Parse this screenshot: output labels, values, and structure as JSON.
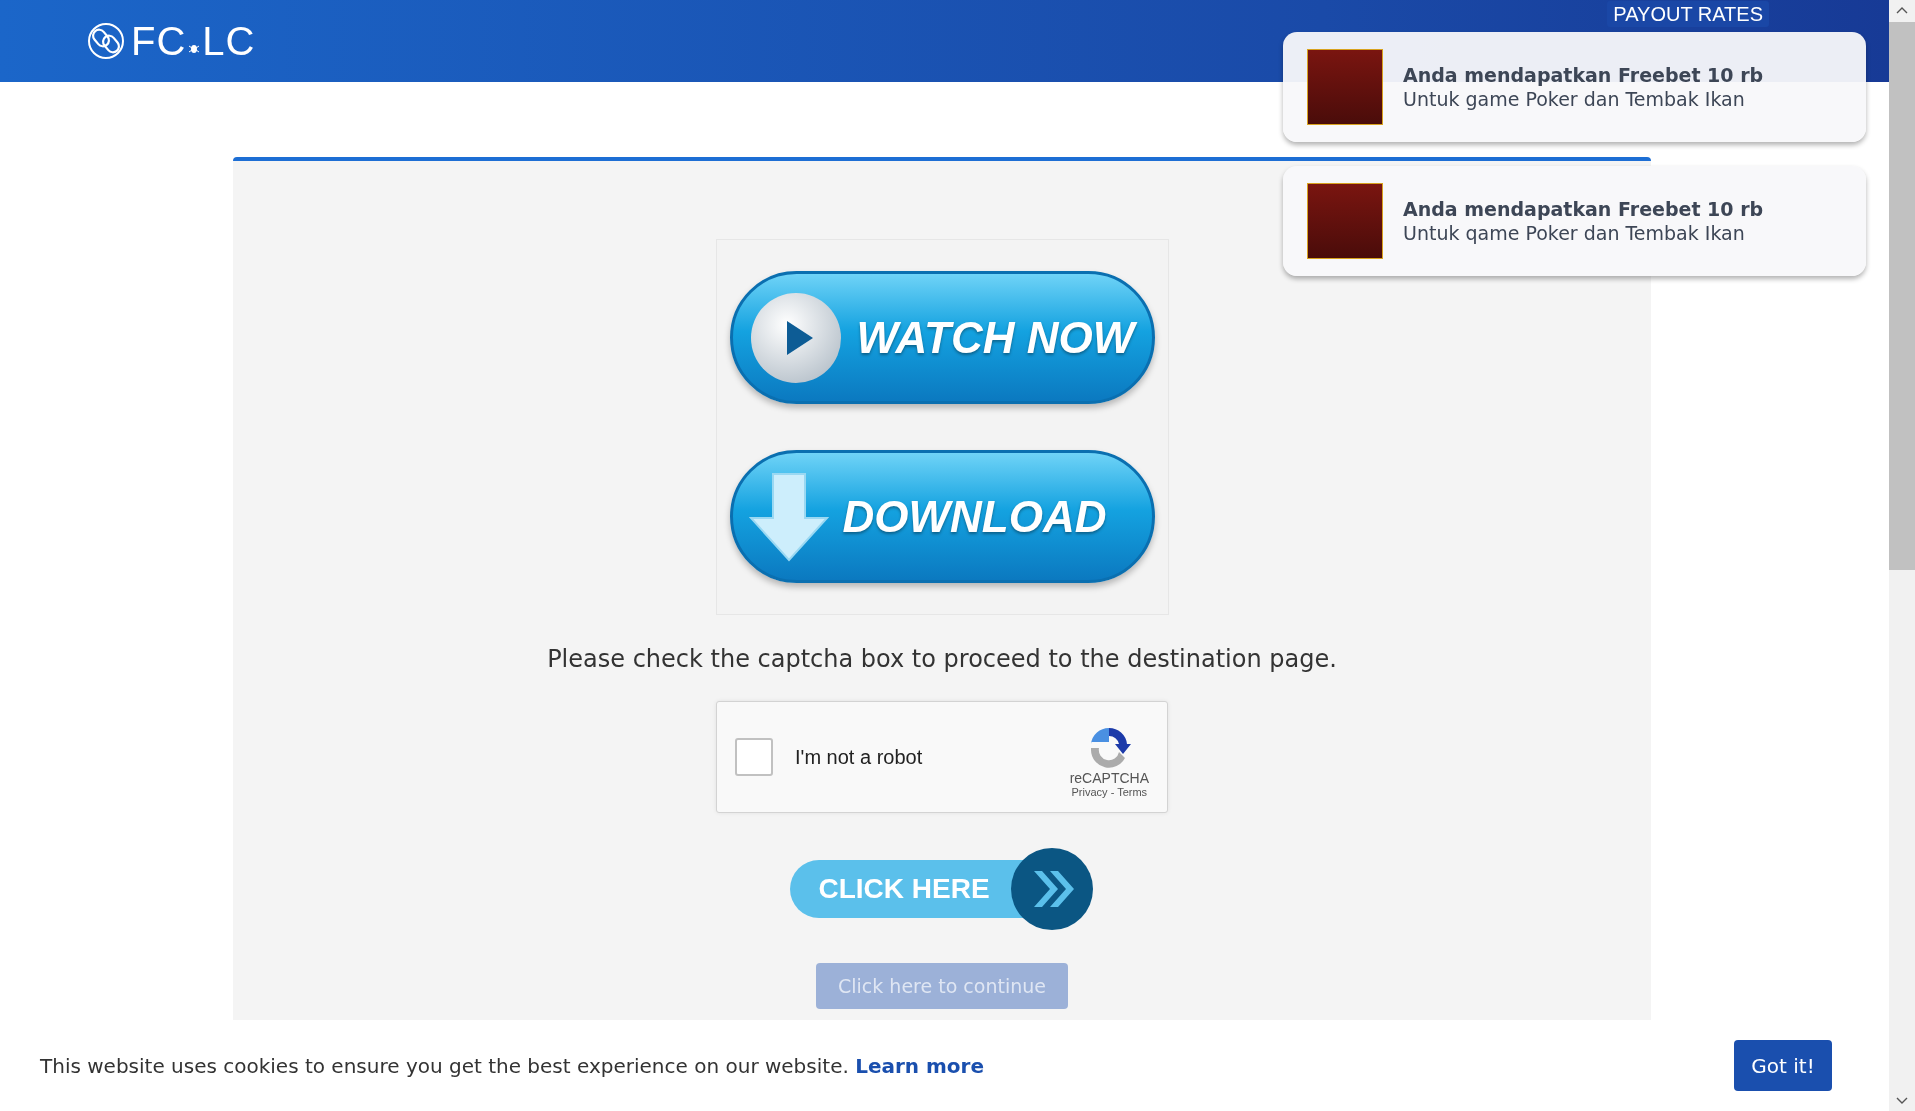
{
  "header": {
    "logo": [
      "FC",
      "LC"
    ],
    "nav": [
      {
        "label": "PAYOUT RATES"
      }
    ]
  },
  "notifications": [
    {
      "title": "Anda mendapatkan Freebet 10 rb",
      "body": "Untuk game Poker dan Tembak Ikan"
    },
    {
      "title": "Anda mendapatkan Freebet 10 rb",
      "body": "Untuk qame Poker dan Tembak Ikan"
    }
  ],
  "promo_buttons": [
    {
      "kind": "watch",
      "label": "WATCH NOW"
    },
    {
      "kind": "download",
      "label": "DOWNLOAD"
    }
  ],
  "instruction": "Please check the captcha box to proceed to the destination page.",
  "captcha": {
    "label": "I'm not a robot",
    "checked": false,
    "brand": "reCAPTCHA",
    "links": "Privacy - Terms"
  },
  "click_here": "CLICK HERE",
  "continue_button": {
    "label": "Click here to continue",
    "disabled": true
  },
  "cookie_bar": {
    "text": "This website uses cookies to ensure you get the best experience on our website.",
    "link": "Learn more",
    "button": "Got it!"
  }
}
